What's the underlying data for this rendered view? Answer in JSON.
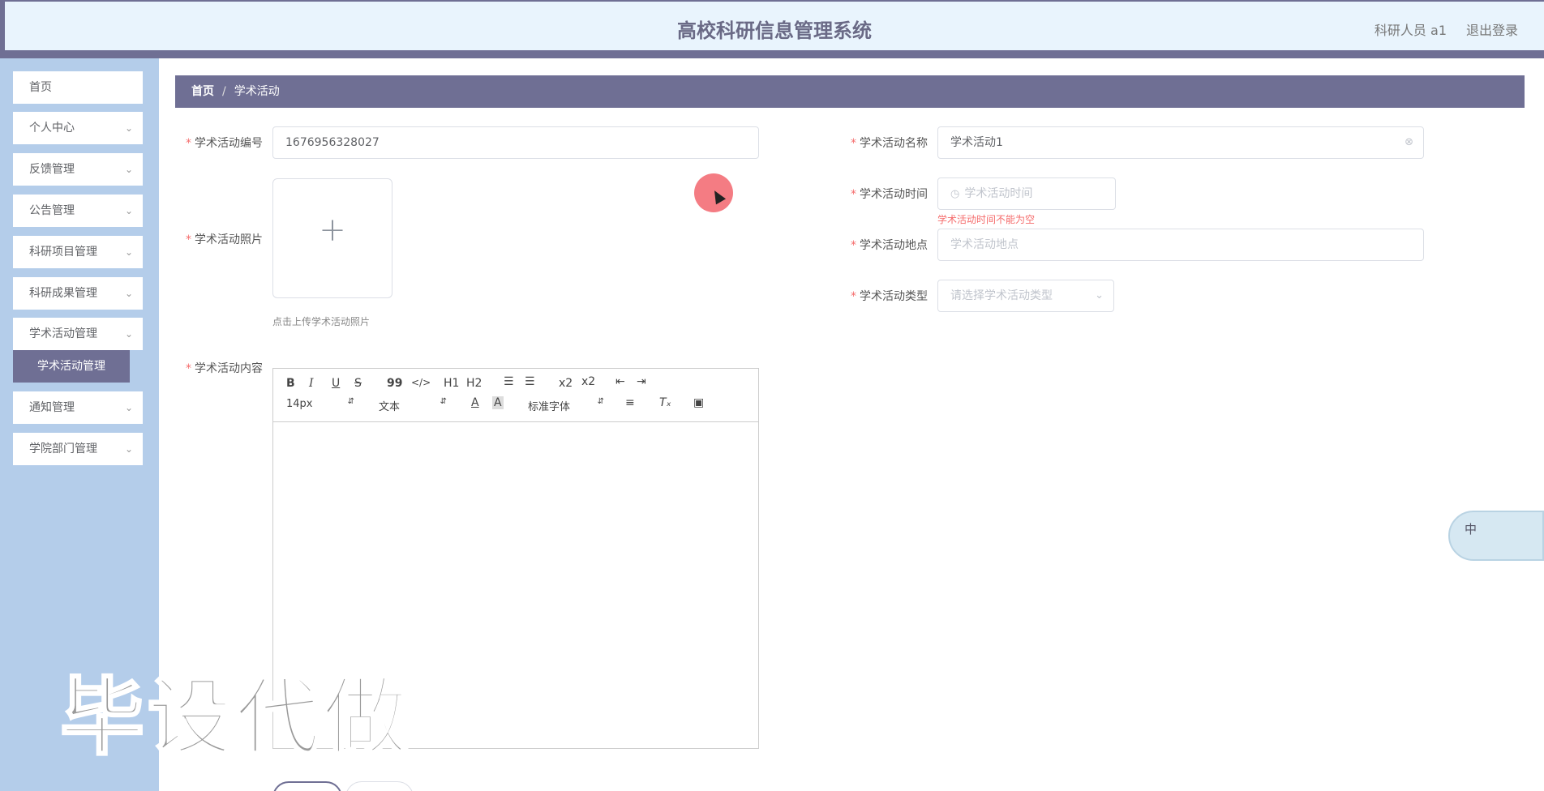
{
  "header": {
    "title": "高校科研信息管理系统",
    "user": "科研人员 a1",
    "logout": "退出登录"
  },
  "sidebar": {
    "items": [
      {
        "label": "首页",
        "has_children": false
      },
      {
        "label": "个人中心",
        "has_children": true
      },
      {
        "label": "反馈管理",
        "has_children": true
      },
      {
        "label": "公告管理",
        "has_children": true
      },
      {
        "label": "科研项目管理",
        "has_children": true
      },
      {
        "label": "科研成果管理",
        "has_children": true
      },
      {
        "label": "学术活动管理",
        "has_children": true
      },
      {
        "label": "通知管理",
        "has_children": true
      },
      {
        "label": "学院部门管理",
        "has_children": true
      }
    ],
    "active_sub": "学术活动管理"
  },
  "breadcrumb": {
    "home": "首页",
    "separator": "/",
    "current": "学术活动"
  },
  "form": {
    "code_label": "学术活动编号",
    "code_value": "1676956328027",
    "name_label": "学术活动名称",
    "name_value": "学术活动1",
    "photo_label": "学术活动照片",
    "photo_tip": "点击上传学术活动照片",
    "time_label": "学术活动时间",
    "time_placeholder": "学术活动时间",
    "time_error": "学术活动时间不能为空",
    "place_label": "学术活动地点",
    "place_placeholder": "学术活动地点",
    "type_label": "学术活动类型",
    "type_placeholder": "请选择学术活动类型",
    "content_label": "学术活动内容",
    "required_mark": "*"
  },
  "editor": {
    "font_size": "14px",
    "paragraph": "文本",
    "font_family": "标准字体",
    "buttons": [
      "B",
      "I",
      "U",
      "S",
      "99",
      "</>",
      "H1",
      "H2",
      "x2",
      "x2"
    ]
  },
  "watermark": "毕设代做",
  "ime": {
    "label": "中"
  },
  "colors": {
    "accent": "#6f6f94",
    "sidebar_bg": "#b4cdea",
    "header_bg": "#e9f4fd",
    "error": "#f56c6c"
  }
}
